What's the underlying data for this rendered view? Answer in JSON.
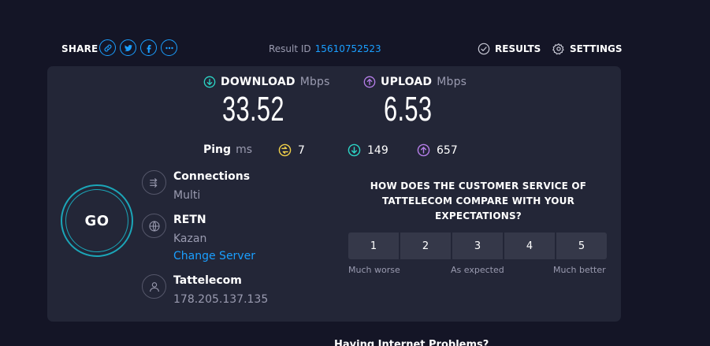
{
  "header": {
    "share_label": "SHARE",
    "share_icons": [
      "link-icon",
      "twitter-icon",
      "facebook-icon",
      "more-icon"
    ],
    "result_id_label": "Result ID",
    "result_id_value": "15610752523",
    "results_label": "RESULTS",
    "settings_label": "SETTINGS"
  },
  "download": {
    "label": "DOWNLOAD",
    "unit": "Mbps",
    "value": "33.52"
  },
  "upload": {
    "label": "UPLOAD",
    "unit": "Mbps",
    "value": "6.53"
  },
  "ping": {
    "label": "Ping",
    "unit": "ms",
    "idle": "7",
    "download": "149",
    "upload": "657"
  },
  "go_label": "GO",
  "connections": {
    "title": "Connections",
    "value": "Multi"
  },
  "server": {
    "title": "RETN",
    "location": "Kazan",
    "change_label": "Change Server"
  },
  "provider": {
    "title": "Tattelecom",
    "ip": "178.205.137.135"
  },
  "survey": {
    "question": "HOW DOES THE CUSTOMER SERVICE OF TATTELECOM COMPARE WITH YOUR EXPECTATIONS?",
    "options": [
      "1",
      "2",
      "3",
      "4",
      "5"
    ],
    "label_low": "Much worse",
    "label_mid": "As expected",
    "label_high": "Much better"
  },
  "footer": {
    "problems_text": "Having Internet Problems?"
  },
  "colors": {
    "background": "#141526",
    "panel": "#232637",
    "accent_blue": "#1a9fff",
    "download_teal": "#2cd4c5",
    "upload_purple": "#b57ee8",
    "ping_yellow": "#f0d04a",
    "go_ring": "#1ba6b8"
  }
}
